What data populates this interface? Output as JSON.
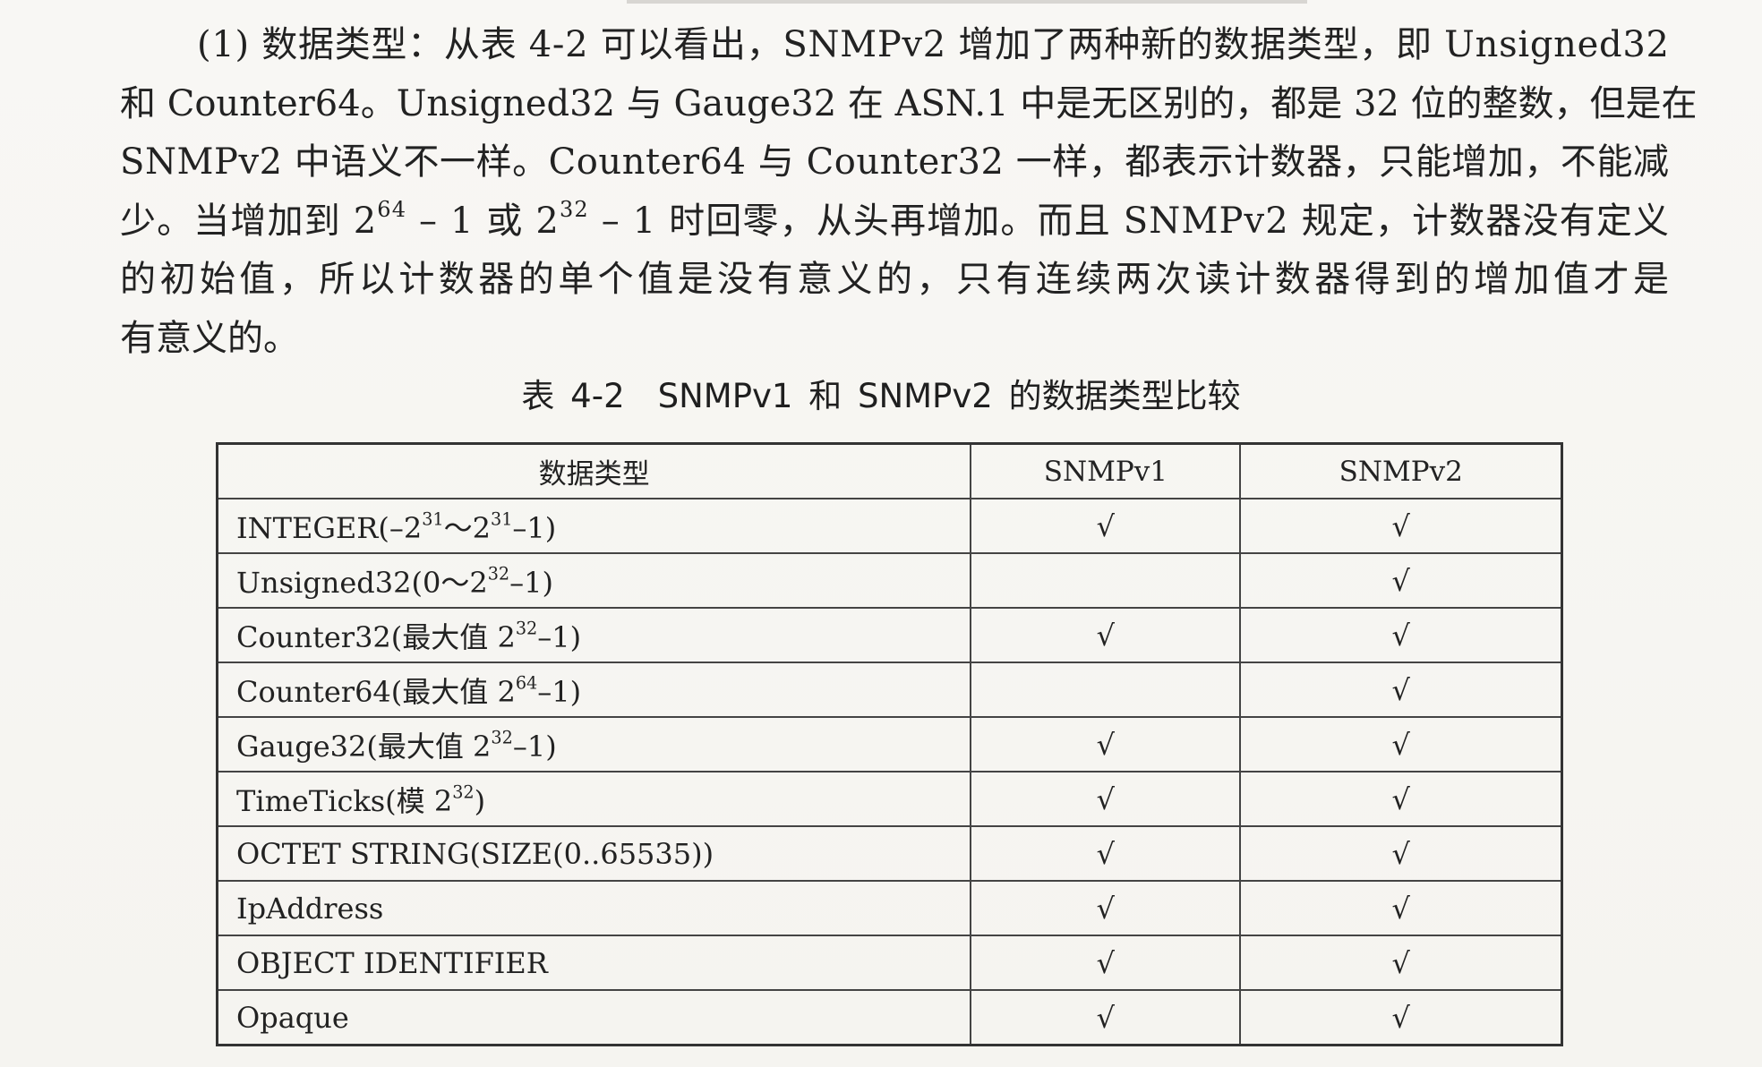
{
  "paragraph": {
    "lines": [
      [
        "(1) 数据类型：从表 4-2 可以看出，SNMPv2 增加了两种新的数据类型，即 Unsigned32"
      ],
      [
        "和 Counter64。Unsigned32 与 Gauge32 在 ASN.1 中是无区别的，都是 32 位的整数，但是在"
      ],
      [
        "SNMPv2 中语义不一样。Counter64 与 Counter32 一样，都表示计数器，只能增加，不能减"
      ],
      [
        "少。当增加到 2",
        "64",
        " – 1 或 2",
        "32",
        " – 1 时回零，从头再增加。而且 SNMPv2 规定，计数器没有定义"
      ],
      [
        "的初始值，所以计数器的单个值是没有意义的，只有连续两次读计数器得到的增加值才是"
      ],
      [
        "有意义的。"
      ]
    ]
  },
  "table": {
    "caption": "表 4-2　SNMPv1 和 SNMPv2 的数据类型比较",
    "headers": [
      "数据类型",
      "SNMPv1",
      "SNMPv2"
    ],
    "check_mark": "√",
    "rows": [
      {
        "type_parts": [
          "INTEGER(–2",
          "31",
          "～2",
          "31",
          "–1)"
        ],
        "v1": "√",
        "v2": "√"
      },
      {
        "type_parts": [
          "Unsigned32(0～2",
          "32",
          "–1)"
        ],
        "v1": "",
        "v2": "√"
      },
      {
        "type_parts": [
          "Counter32(最大值 2",
          "32",
          "–1)"
        ],
        "v1": "√",
        "v2": "√"
      },
      {
        "type_parts": [
          "Counter64(最大值 2",
          "64",
          "–1)"
        ],
        "v1": "",
        "v2": "√"
      },
      {
        "type_parts": [
          "Gauge32(最大值 2",
          "32",
          "–1)"
        ],
        "v1": "√",
        "v2": "√"
      },
      {
        "type_parts": [
          "TimeTicks(模 2",
          "32",
          ")"
        ],
        "v1": "√",
        "v2": "√"
      },
      {
        "type_parts": [
          "OCTET STRING(SIZE(0..65535))"
        ],
        "v1": "√",
        "v2": "√"
      },
      {
        "type_parts": [
          "IpAddress"
        ],
        "v1": "√",
        "v2": "√"
      },
      {
        "type_parts": [
          "OBJECT IDENTIFIER"
        ],
        "v1": "√",
        "v2": "√"
      },
      {
        "type_parts": [
          "Opaque"
        ],
        "v1": "√",
        "v2": "√"
      }
    ]
  }
}
